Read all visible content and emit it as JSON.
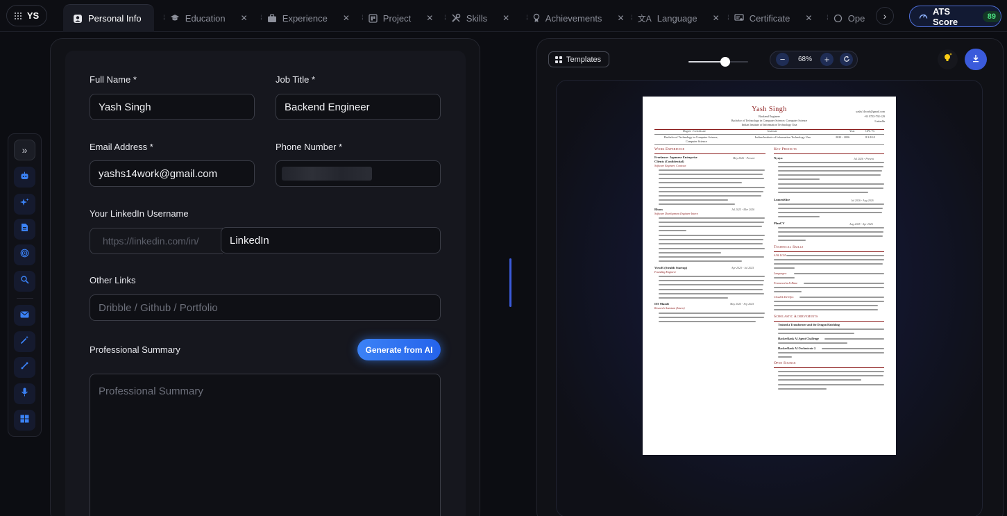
{
  "app": {
    "initials": "YS"
  },
  "tabs": [
    {
      "label": "Personal Info",
      "icon": "user-icon",
      "active": true
    },
    {
      "label": "Education",
      "icon": "graduation-cap-icon"
    },
    {
      "label": "Experience",
      "icon": "briefcase-icon"
    },
    {
      "label": "Project",
      "icon": "project-icon"
    },
    {
      "label": "Skills",
      "icon": "tools-icon"
    },
    {
      "label": "Achievements",
      "icon": "medal-icon"
    },
    {
      "label": "Language",
      "icon": "translate-icon"
    },
    {
      "label": "Certificate",
      "icon": "certificate-icon"
    },
    {
      "label": "Ope",
      "icon": "open-source-icon"
    }
  ],
  "ats": {
    "label": "ATS Score",
    "score": "89"
  },
  "form": {
    "full_name": {
      "label": "Full Name *",
      "value": "Yash Singh"
    },
    "job_title": {
      "label": "Job Title *",
      "value": "Backend Engineer"
    },
    "email": {
      "label": "Email Address *",
      "value": "yashs14work@gmail.com"
    },
    "phone": {
      "label": "Phone Number *"
    },
    "linkedin": {
      "label": "Your LinkedIn Username",
      "prefix": "https://linkedin.com/in/",
      "value": "LinkedIn"
    },
    "other_links": {
      "label": "Other Links",
      "placeholder": "Dribble / Github / Portfolio"
    },
    "summary": {
      "label": "Professional Summary",
      "placeholder": "Professional Summary",
      "generate_button": "Generate from AI"
    }
  },
  "preview": {
    "templates_label": "Templates",
    "zoom": "68%",
    "zoom_level": 0.62,
    "resume": {
      "name": "Yash Singh",
      "title": "Backend Engineer",
      "degree_line": "Bachelor of Technology in Computer Science; Computer Science",
      "institute_line": "Indian Institute of Information Technology Una",
      "contact": [
        "yashs14work@gmail.com",
        "+91 8735-792-129",
        "LinkedIn"
      ],
      "edu_headers": [
        "Degree / Certificate",
        "Institute",
        "Year",
        "CPI / %"
      ],
      "edu_row": [
        "Bachelor of Technology in Computer Science,",
        "Computer Science",
        "Indian Institute of Information Technology Una",
        "2022 - 2026",
        "8.3/10.0"
      ],
      "sections": {
        "work": "Work Experience",
        "projects": "Key Projects",
        "skills": "Technical Skills",
        "achievements": "Scholastic Achievements",
        "open_source": "Open Source"
      },
      "work": [
        {
          "company": "Freelance: Japanese Enterprise",
          "company2": "Clients (Confidential)",
          "date": "May 2026 - Present",
          "role": "Software Engineer, Contract"
        },
        {
          "company": "Bluon",
          "date": "Jul 2025 - Mar 2026",
          "role": "Software Development Engineer Intern"
        },
        {
          "company": "ViewR (Stealth Startup)",
          "date": "Apr 2025 - Jul 2025",
          "role": "Founding Engineer"
        },
        {
          "company": "IIT Mandi",
          "date": "May 2025 - Sep 2025",
          "role": "Research Assistant (Intern)"
        }
      ],
      "projects": [
        {
          "name": "Nyaya",
          "date": "Jul 2026 - Present"
        },
        {
          "name": "LumenSlice",
          "date": "Jul 2026 - Aug 2026"
        },
        {
          "name": "PlanCV",
          "date": "Aug 2025 - Apr 2026"
        }
      ],
      "skill_labels": [
        "AI & LLM:",
        "Languages:",
        "Frameworks & Data:",
        "Cloud & DevOps:"
      ],
      "achievements": [
        "Trained a Transformer and the Dragon Hatchling",
        "HackerRank AI Agent Challenge",
        "HackerRank AI Orchestrate 2."
      ]
    }
  }
}
